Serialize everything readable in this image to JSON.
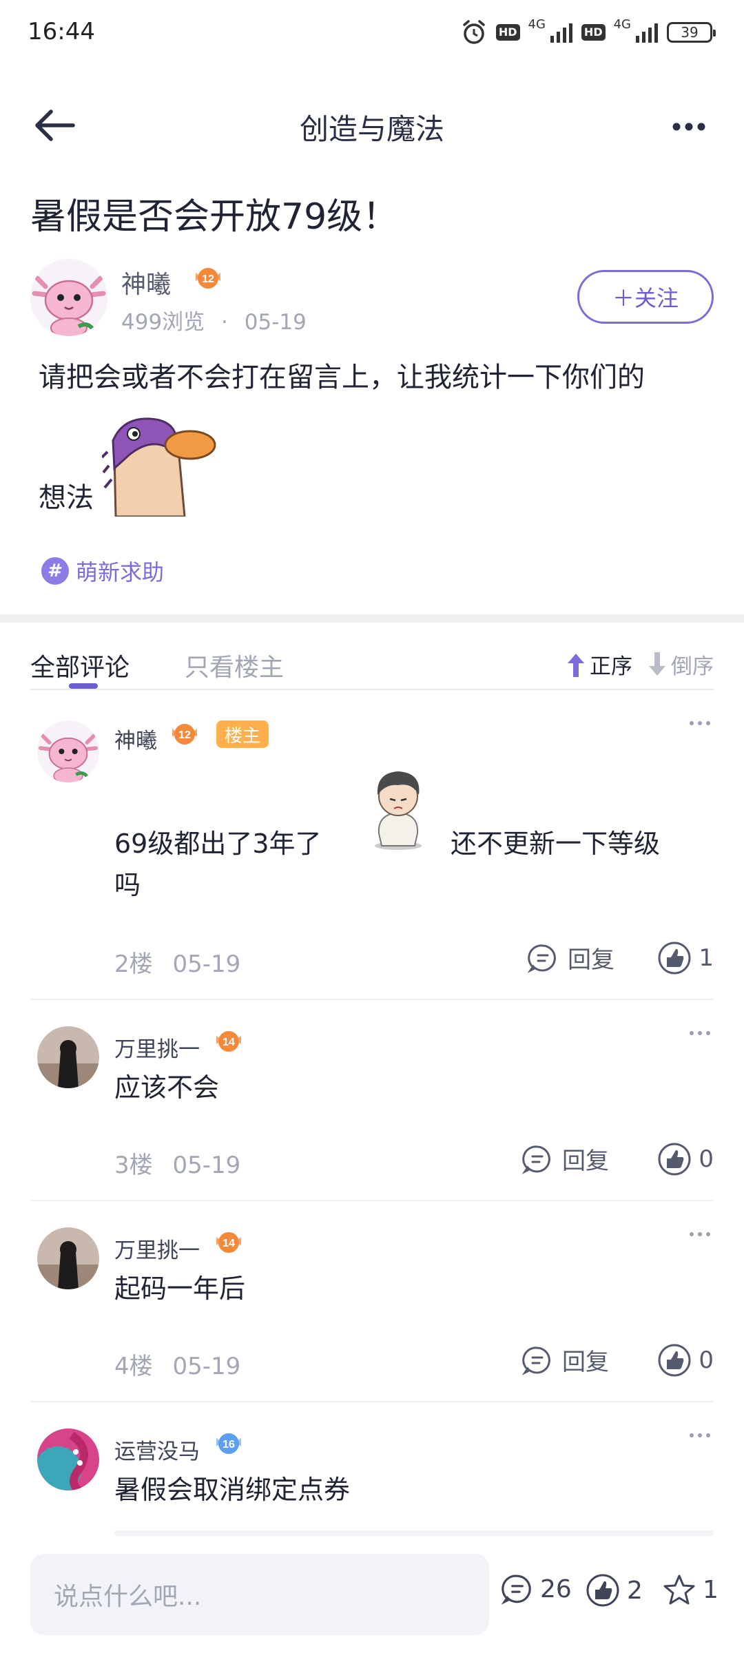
{
  "status_bar": {
    "time": "16:44",
    "network_1": "4G",
    "network_2": "4G",
    "hd_1": "HD",
    "hd_2": "HD",
    "battery": "39"
  },
  "nav": {
    "title": "创造与魔法"
  },
  "post": {
    "title": "暑假是否会开放79级！",
    "author": {
      "name": "神曦",
      "level": "12",
      "views": "499浏览",
      "separator": "·",
      "date": "05-19"
    },
    "follow_label": "＋关注",
    "body_line1": "请把会或者不会打在留言上，让我统计一下你们的",
    "body_line2": "想法",
    "topic": "萌新求助",
    "topic_symbol": "#"
  },
  "tabs": {
    "all": "全部评论",
    "owner_only": "只看楼主",
    "sort_asc": "正序",
    "sort_desc": "倒序"
  },
  "comments": [
    {
      "name": "神曦",
      "level": "12",
      "owner_tag": "楼主",
      "text_a": "69级都出了3年了",
      "text_b": "还不更新一下等级",
      "text_c": "吗",
      "floor": "2楼",
      "date": "05-19",
      "reply_label": "回复",
      "likes": "1"
    },
    {
      "name": "万里挑一",
      "level": "14",
      "text": "应该不会",
      "floor": "3楼",
      "date": "05-19",
      "reply_label": "回复",
      "likes": "0"
    },
    {
      "name": "万里挑一",
      "level": "14",
      "text": "起码一年后",
      "floor": "4楼",
      "date": "05-19",
      "reply_label": "回复",
      "likes": "0"
    },
    {
      "name": "运营没马",
      "level": "16",
      "text": "暑假会取消绑定点券"
    }
  ],
  "bottom_bar": {
    "input_placeholder": "说点什么吧...",
    "comments_count": "26",
    "likes_count": "2",
    "stars_count": "1"
  },
  "colors": {
    "accent": "#6c5dd3",
    "owner_tag": "#ffb04c",
    "level_orange": "#f5893a",
    "level_blue": "#5aa0ee",
    "muted": "#a2a6b5"
  }
}
